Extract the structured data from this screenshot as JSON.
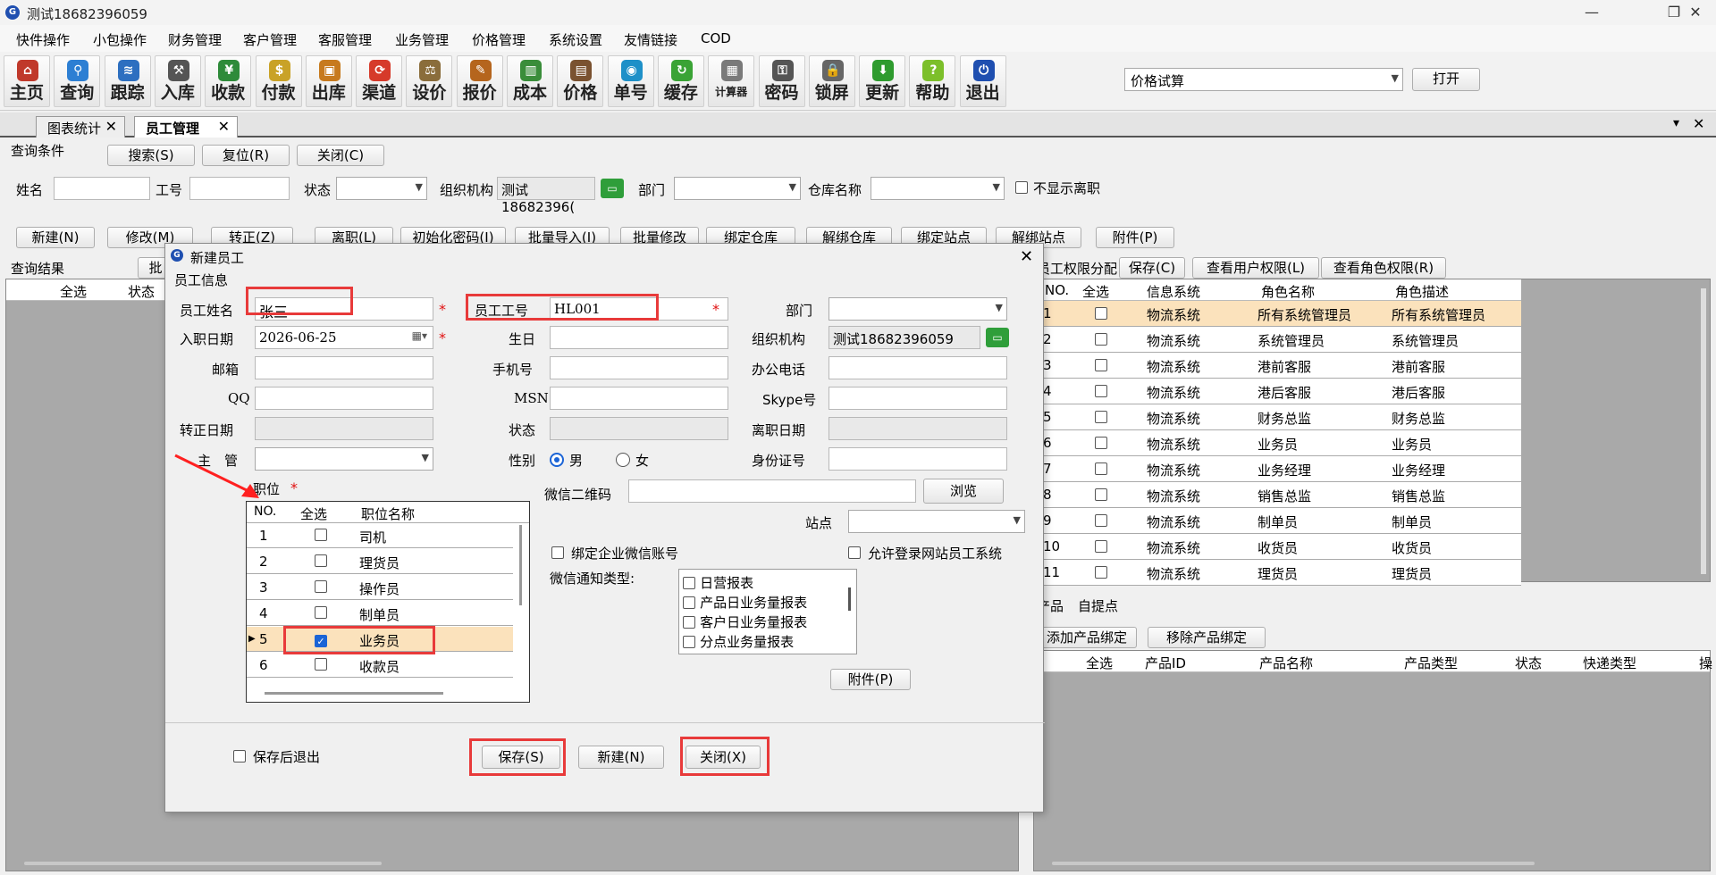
{
  "window": {
    "title": "测试18682396059",
    "app_icon": "G",
    "minimize": "—",
    "maximize": "❐",
    "close": "✕"
  },
  "menu": [
    "快件操作",
    "小包操作",
    "财务管理",
    "客户管理",
    "客服管理",
    "业务管理",
    "价格管理",
    "系统设置",
    "友情链接",
    "COD"
  ],
  "toolbar": [
    {
      "label": "主页",
      "icon": "home-icon",
      "color": "#c0392b",
      "glyph": "⌂"
    },
    {
      "label": "查询",
      "icon": "magnifier-icon",
      "color": "#2d7fd3",
      "glyph": "⚲"
    },
    {
      "label": "跟踪",
      "icon": "wifi-icon",
      "color": "#2d6fc0",
      "glyph": "≋"
    },
    {
      "label": "入库",
      "icon": "hammer-icon",
      "color": "#555555",
      "glyph": "⚒"
    },
    {
      "label": "收款",
      "icon": "yen-icon",
      "color": "#2e8b3a",
      "glyph": "¥"
    },
    {
      "label": "付款",
      "icon": "payment-icon",
      "color": "#c9a227",
      "glyph": "$"
    },
    {
      "label": "出库",
      "icon": "box-icon",
      "color": "#c77a1e",
      "glyph": "▣"
    },
    {
      "label": "渠道",
      "icon": "channel-icon",
      "color": "#d63a2a",
      "glyph": "⟳"
    },
    {
      "label": "设价",
      "icon": "scale-icon",
      "color": "#8a6d3b",
      "glyph": "⚖"
    },
    {
      "label": "报价",
      "icon": "quote-icon",
      "color": "#b5651d",
      "glyph": "✎"
    },
    {
      "label": "成本",
      "icon": "chart-icon",
      "color": "#3a8d3a",
      "glyph": "▥"
    },
    {
      "label": "价格",
      "icon": "price-icon",
      "color": "#7a5230",
      "glyph": "▤"
    },
    {
      "label": "单号",
      "icon": "eye-icon",
      "color": "#1e90c8",
      "glyph": "◉"
    },
    {
      "label": "缓存",
      "icon": "refresh-icon",
      "color": "#3aa335",
      "glyph": "↻"
    },
    {
      "label": "计算器",
      "icon": "calculator-icon",
      "color": "#7a7a7a",
      "glyph": "▦",
      "small": true
    },
    {
      "label": "密码",
      "icon": "key-icon",
      "color": "#555555",
      "glyph": "⚿"
    },
    {
      "label": "锁屏",
      "icon": "lock-icon",
      "color": "#666666",
      "glyph": "🔒"
    },
    {
      "label": "更新",
      "icon": "download-icon",
      "color": "#2e9b2e",
      "glyph": "⬇"
    },
    {
      "label": "帮助",
      "icon": "help-icon",
      "color": "#7cbf2a",
      "glyph": "?"
    },
    {
      "label": "退出",
      "icon": "power-icon",
      "color": "#1f4fb0",
      "glyph": "⏻"
    }
  ],
  "calc_select": {
    "value": "价格试算"
  },
  "open_button": "打开",
  "tabs": [
    {
      "label": "图表统计",
      "close": "✕"
    },
    {
      "label": "员工管理",
      "close": "✕"
    }
  ],
  "tab_tools": {
    "dropdown": "▾",
    "close": "✕"
  },
  "query": {
    "legend": "查询条件",
    "search": "搜索(S)",
    "reset": "复位(R)",
    "close": "关闭(C)",
    "name_label": "姓名",
    "empno_label": "工号",
    "status_label": "状态",
    "org_label": "组织机构",
    "org_value": "测试18682396(",
    "dept_label": "部门",
    "warehouse_label": "仓库名称",
    "hide_left": "不显示离职"
  },
  "actions": [
    "新建(N)",
    "修改(M)",
    "转正(Z)",
    "离职(L)",
    "初始化密码(I)",
    "批量导入(I)",
    "批量修改",
    "绑定仓库",
    "解绑仓库",
    "绑定站点",
    "解绑站点",
    "附件(P)"
  ],
  "results": {
    "label": "查询结果",
    "cols": [
      "全选",
      "状态"
    ],
    "batch": "批"
  },
  "perm": {
    "title": "员工权限分配",
    "save": "保存(C)",
    "view_user": "查看用户权限(L)",
    "view_role": "查看角色权限(R)",
    "cols": [
      "NO.",
      "全选",
      "信息系统",
      "角色名称",
      "角色描述"
    ],
    "rows": [
      {
        "no": "1",
        "sys": "物流系统",
        "role": "所有系统管理员",
        "desc": "所有系统管理员"
      },
      {
        "no": "2",
        "sys": "物流系统",
        "role": "系统管理员",
        "desc": "系统管理员"
      },
      {
        "no": "3",
        "sys": "物流系统",
        "role": "港前客服",
        "desc": "港前客服"
      },
      {
        "no": "4",
        "sys": "物流系统",
        "role": "港后客服",
        "desc": "港后客服"
      },
      {
        "no": "5",
        "sys": "物流系统",
        "role": "财务总监",
        "desc": "财务总监"
      },
      {
        "no": "6",
        "sys": "物流系统",
        "role": "业务员",
        "desc": "业务员"
      },
      {
        "no": "7",
        "sys": "物流系统",
        "role": "业务经理",
        "desc": "业务经理"
      },
      {
        "no": "8",
        "sys": "物流系统",
        "role": "销售总监",
        "desc": "销售总监"
      },
      {
        "no": "9",
        "sys": "物流系统",
        "role": "制单员",
        "desc": "制单员"
      },
      {
        "no": "10",
        "sys": "物流系统",
        "role": "收货员",
        "desc": "收货员"
      },
      {
        "no": "11",
        "sys": "物流系统",
        "role": "理货员",
        "desc": "理货员"
      }
    ]
  },
  "product": {
    "tab1": "产品",
    "tab2": "自提点",
    "add": "添加产品绑定",
    "remove": "移除产品绑定",
    "cols": [
      "全选",
      "产品ID",
      "产品名称",
      "产品类型",
      "状态",
      "快递类型",
      "操"
    ]
  },
  "dialog": {
    "title": "新建员工",
    "close": "✕",
    "section": "员工信息",
    "name_label": "员工姓名",
    "name_value": "张三",
    "empno_label": "员工工号",
    "empno_value": "HL001",
    "dept_label": "部门",
    "hire_label": "入职日期",
    "hire_value": "2026-06-25",
    "birthday_label": "生日",
    "org_label": "组织机构",
    "org_value": "测试18682396059",
    "email_label": "邮箱",
    "mobile_label": "手机号",
    "office_label": "办公电话",
    "qq_label": "QQ",
    "msn_label": "MSN",
    "skype_label": "Skype号",
    "regular_label": "转正日期",
    "status_label": "状态",
    "leave_label": "离职日期",
    "manager_label": "主　管",
    "gender_label": "性别",
    "male": "男",
    "female": "女",
    "idcard_label": "身份证号",
    "position_label": "职位",
    "required": "*",
    "pos_cols": [
      "NO.",
      "全选",
      "职位名称"
    ],
    "positions": [
      {
        "no": "1",
        "name": "司机",
        "checked": false
      },
      {
        "no": "2",
        "name": "理货员",
        "checked": false
      },
      {
        "no": "3",
        "name": "操作员",
        "checked": false
      },
      {
        "no": "4",
        "name": "制单员",
        "checked": false
      },
      {
        "no": "5",
        "name": "业务员",
        "checked": true
      },
      {
        "no": "6",
        "name": "收款员",
        "checked": false
      }
    ],
    "wechat_qr_label": "微信二维码",
    "browse": "浏览",
    "site_label": "站点",
    "bind_wechat": "绑定企业微信账号",
    "allow_site_login": "允许登录网站员工系统",
    "notify_label": "微信通知类型:",
    "notify_types": [
      "日营报表",
      "产品日业务量报表",
      "客户日业务量报表",
      "分点业务量报表"
    ],
    "attach": "附件(P)",
    "save_exit": "保存后退出",
    "save": "保存(S)",
    "new": "新建(N)",
    "close_btn": "关闭(X)"
  }
}
